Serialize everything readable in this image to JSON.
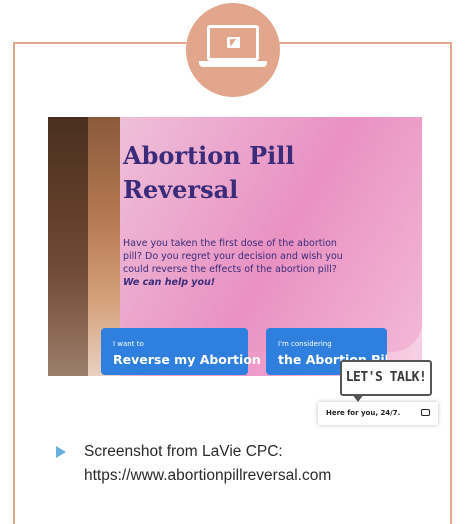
{
  "hero": {
    "title": "Abortion Pill Reversal",
    "body": "Have you taken the first dose of the abortion pill? Do you regret your decision and wish you could reverse the effects of the abortion pill?",
    "emphasis": "We can help you!"
  },
  "buttons": {
    "reverse": {
      "small": "I want to",
      "big": "Reverse my Abortion"
    },
    "consider": {
      "small": "I'm considering",
      "big": "the Abortion Pill"
    }
  },
  "chat": {
    "bubble": "LET'S TALK!",
    "bar": "Here for you, 24/7."
  },
  "caption": "Screenshot from LaVie CPC: https://www.abortionpillreversal.com",
  "colors": {
    "frame": "#e1a68c",
    "button": "#2f7fde",
    "title": "#3a2c7a",
    "bullet": "#6aaedc"
  }
}
